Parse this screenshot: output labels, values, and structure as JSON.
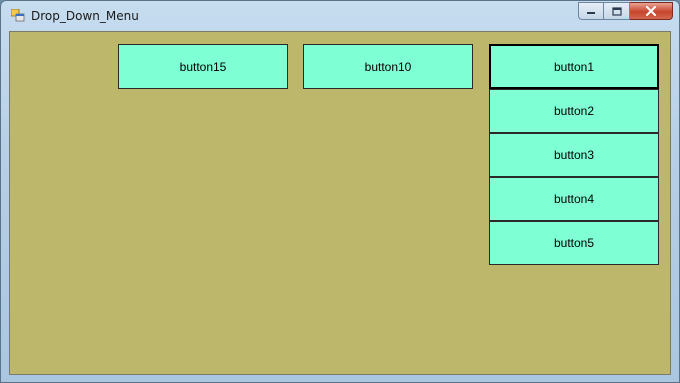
{
  "window": {
    "title": "Drop_Down_Menu"
  },
  "buttons": {
    "button15": "button15",
    "button10": "button10",
    "button1": "button1",
    "button2": "button2",
    "button3": "button3",
    "button4": "button4",
    "button5": "button5"
  },
  "colors": {
    "form_background": "#bdb76b",
    "button_background": "#7fffd4"
  }
}
